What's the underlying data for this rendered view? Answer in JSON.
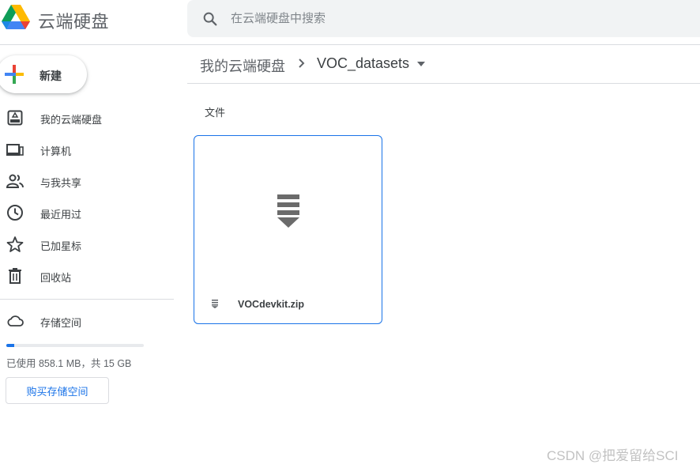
{
  "app": {
    "title": "云端硬盘"
  },
  "search": {
    "placeholder": "在云端硬盘中搜索",
    "value": ""
  },
  "sidebar": {
    "new_label": "新建",
    "items": [
      {
        "label": "我的云端硬盘",
        "icon": "my-drive-icon"
      },
      {
        "label": "计算机",
        "icon": "computer-icon"
      },
      {
        "label": "与我共享",
        "icon": "shared-people-icon"
      },
      {
        "label": "最近用过",
        "icon": "clock-icon"
      },
      {
        "label": "已加星标",
        "icon": "star-icon"
      },
      {
        "label": "回收站",
        "icon": "trash-icon"
      }
    ],
    "storage": {
      "label": "存储空间",
      "icon": "cloud-icon",
      "usage_text": "已使用 858.1 MB，共 15 GB",
      "used_fraction": 0.056,
      "buy_label": "购买存储空间"
    }
  },
  "breadcrumb": {
    "root": "我的云端硬盘",
    "current": "VOC_datasets"
  },
  "main": {
    "section_label": "文件",
    "files": [
      {
        "name": "VOCdevkit.zip",
        "icon": "zip-icon"
      }
    ]
  },
  "watermark": "CSDN @把爱留给SCI",
  "colors": {
    "accent": "#1a73e8",
    "text": "#3c4043",
    "muted": "#5f6368",
    "search_bg": "#f1f3f4",
    "divider": "#dadce0"
  }
}
